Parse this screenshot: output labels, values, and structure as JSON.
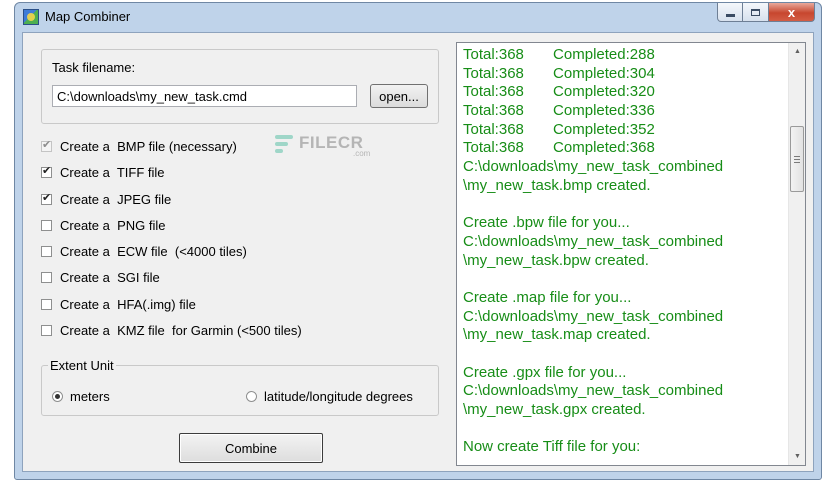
{
  "window": {
    "title": "Map Combiner",
    "close_glyph": "x",
    "icon": "map-app-icon"
  },
  "task": {
    "label": "Task filename:",
    "value": "C:\\downloads\\my_new_task.cmd",
    "open_label": "open..."
  },
  "watermark": {
    "text": "FILECR",
    "sub": ".com"
  },
  "options": [
    {
      "label": "Create a  BMP file (necessary)",
      "checked": true,
      "disabled": true
    },
    {
      "label": "Create a  TIFF file",
      "checked": true,
      "disabled": false
    },
    {
      "label": "Create a  JPEG file",
      "checked": true,
      "disabled": false
    },
    {
      "label": "Create a  PNG file",
      "checked": false,
      "disabled": false
    },
    {
      "label": "Create a  ECW file  (<4000 tiles)",
      "checked": false,
      "disabled": false
    },
    {
      "label": "Create a  SGI file",
      "checked": false,
      "disabled": false
    },
    {
      "label": "Create a  HFA(.img) file",
      "checked": false,
      "disabled": false
    },
    {
      "label": "Create a  KMZ file  for Garmin (<500 tiles)",
      "checked": false,
      "disabled": false
    }
  ],
  "extent": {
    "legend": "Extent Unit",
    "meters_label": "meters",
    "latlon_label": "latitude/longitude degrees",
    "selected": "meters"
  },
  "combine_label": "Combine",
  "log": {
    "color": "#178d17",
    "lines": [
      "Total:368       Completed:288",
      "Total:368       Completed:304",
      "Total:368       Completed:320",
      "Total:368       Completed:336",
      "Total:368       Completed:352",
      "Total:368       Completed:368",
      "C:\\downloads\\my_new_task_combined",
      "\\my_new_task.bmp created.",
      "",
      "Create .bpw file for you...",
      "C:\\downloads\\my_new_task_combined",
      "\\my_new_task.bpw created.",
      "",
      "Create .map file for you...",
      "C:\\downloads\\my_new_task_combined",
      "\\my_new_task.map created.",
      "",
      "Create .gpx file for you...",
      "C:\\downloads\\my_new_task_combined",
      "\\my_new_task.gpx created.",
      "",
      "Now create Tiff file for you:"
    ]
  }
}
